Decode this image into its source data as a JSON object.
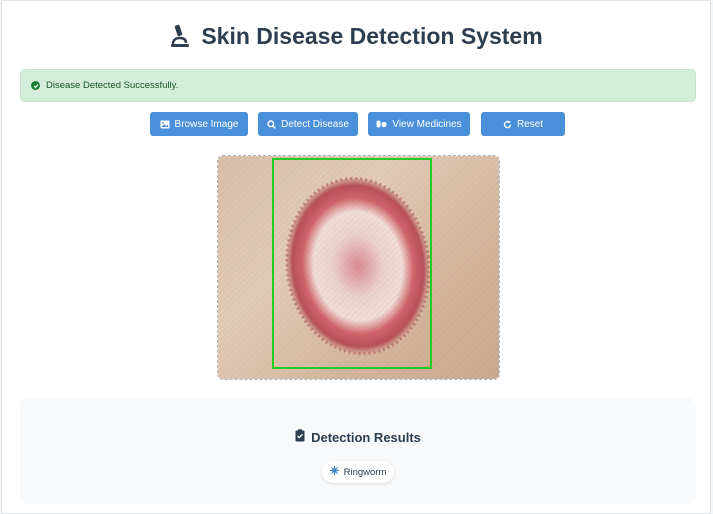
{
  "header": {
    "title": "Skin Disease Detection System",
    "icon": "microscope-icon"
  },
  "alert": {
    "message": "Disease Detected Successfully.",
    "type": "success",
    "color": "#d4edda"
  },
  "toolbar": {
    "browse_label": "Browse Image",
    "detect_label": "Detect Disease",
    "medicines_label": "View Medicines",
    "reset_label": "Reset",
    "button_color": "#4a8fd9"
  },
  "preview": {
    "detection_box_color": "#22cc22"
  },
  "results": {
    "title": "Detection Results",
    "disease": "Ringworm"
  }
}
